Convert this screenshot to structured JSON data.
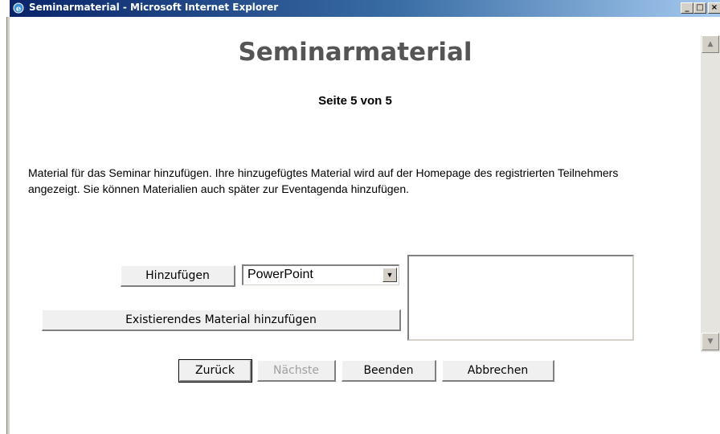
{
  "window": {
    "title": "Seminarmaterial - Microsoft Internet Explorer",
    "icon": "ie-icon",
    "controls": {
      "minimize": "_",
      "maximize": "□",
      "close": "×"
    }
  },
  "page": {
    "title": "Seminarmaterial",
    "indicator": "Seite 5 von 5",
    "description": "Material für das Seminar hinzufügen. Ihre hinzugefügtes Material wird auf der Homepage des registrierten Teilnehmers angezeigt. Sie können Materialien auch später zur Eventagenda hinzufügen."
  },
  "material": {
    "add_label": "Hinzufügen",
    "type_selected": "PowerPoint",
    "add_existing_label": "Existierendes Material hinzufügen",
    "list_items": []
  },
  "navigation": {
    "back_label": "Zurück",
    "next_label": "Nächste",
    "finish_label": "Beenden",
    "cancel_label": "Abbrechen"
  },
  "colors": {
    "titlebar_start": "#0a246a",
    "titlebar_end": "#a6caf0",
    "page_title": "#555555",
    "disabled_text": "#a0a0a0"
  }
}
